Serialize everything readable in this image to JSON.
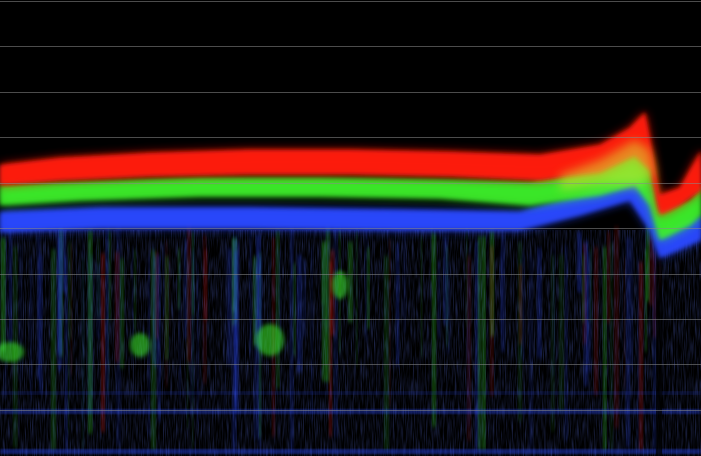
{
  "scope": {
    "type": "rgb-parade-waveform",
    "background_color": "#000000",
    "graticule_color": "#8a8a8a",
    "graticule_lines": 10,
    "channels": [
      {
        "name": "red",
        "color": "#ff1a10"
      },
      {
        "name": "green",
        "color": "#3cf02a"
      },
      {
        "name": "blue",
        "color": "#2a48ff"
      }
    ]
  }
}
